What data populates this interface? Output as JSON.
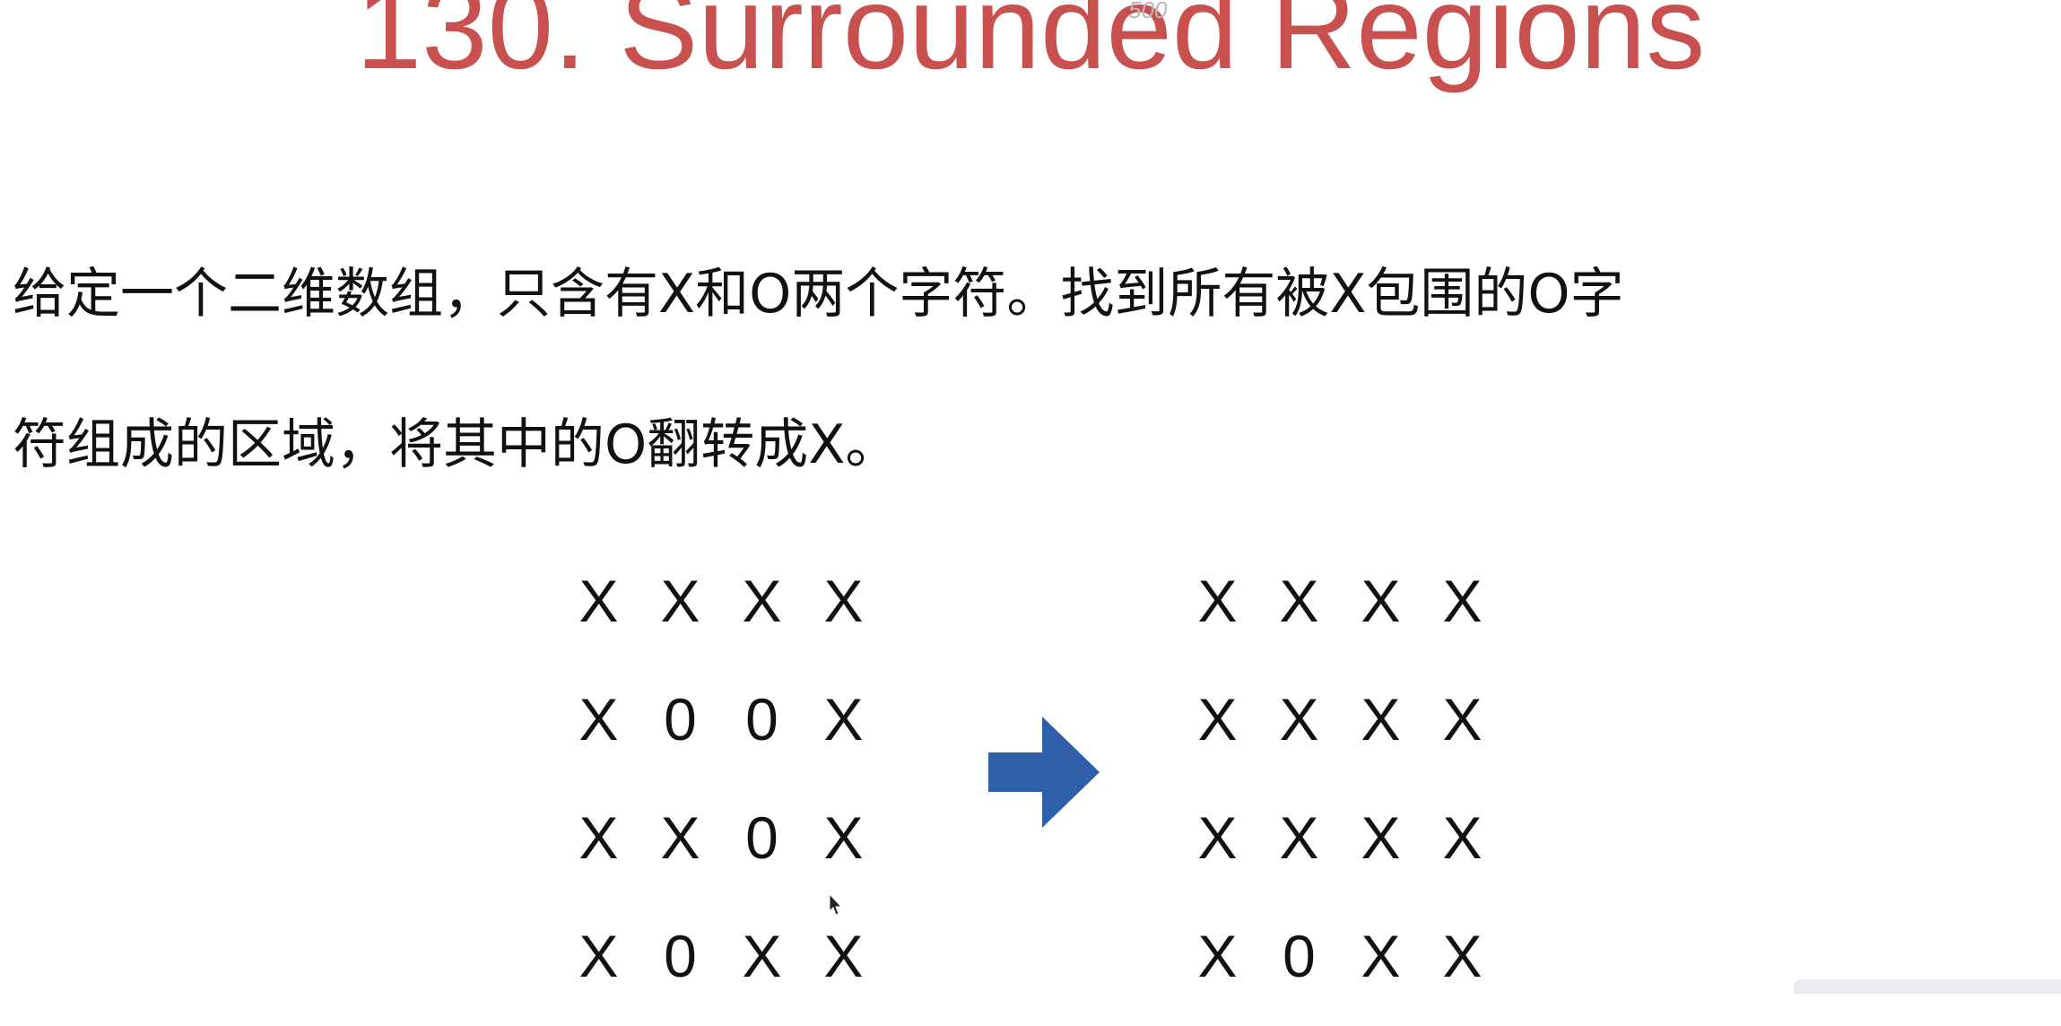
{
  "title": "130. Surrounded Regions",
  "watermark": "500",
  "description": {
    "line1": "给定一个二维数组，只含有X和O两个字符。找到所有被X包围的O字",
    "line2": "符组成的区域，将其中的O翻转成X。"
  },
  "grid_before": [
    [
      "X",
      "X",
      "X",
      "X"
    ],
    [
      "X",
      "0",
      "0",
      "X"
    ],
    [
      "X",
      "X",
      "0",
      "X"
    ],
    [
      "X",
      "0",
      "X",
      "X"
    ]
  ],
  "grid_after": [
    [
      "X",
      "X",
      "X",
      "X"
    ],
    [
      "X",
      "X",
      "X",
      "X"
    ],
    [
      "X",
      "X",
      "X",
      "X"
    ],
    [
      "X",
      "0",
      "X",
      "X"
    ]
  ],
  "colors": {
    "title": "#c8504f",
    "arrow": "#2f5fa8",
    "text": "#111111"
  },
  "icons": {
    "arrow": "right-arrow-icon",
    "cursor": "mouse-cursor-icon"
  }
}
